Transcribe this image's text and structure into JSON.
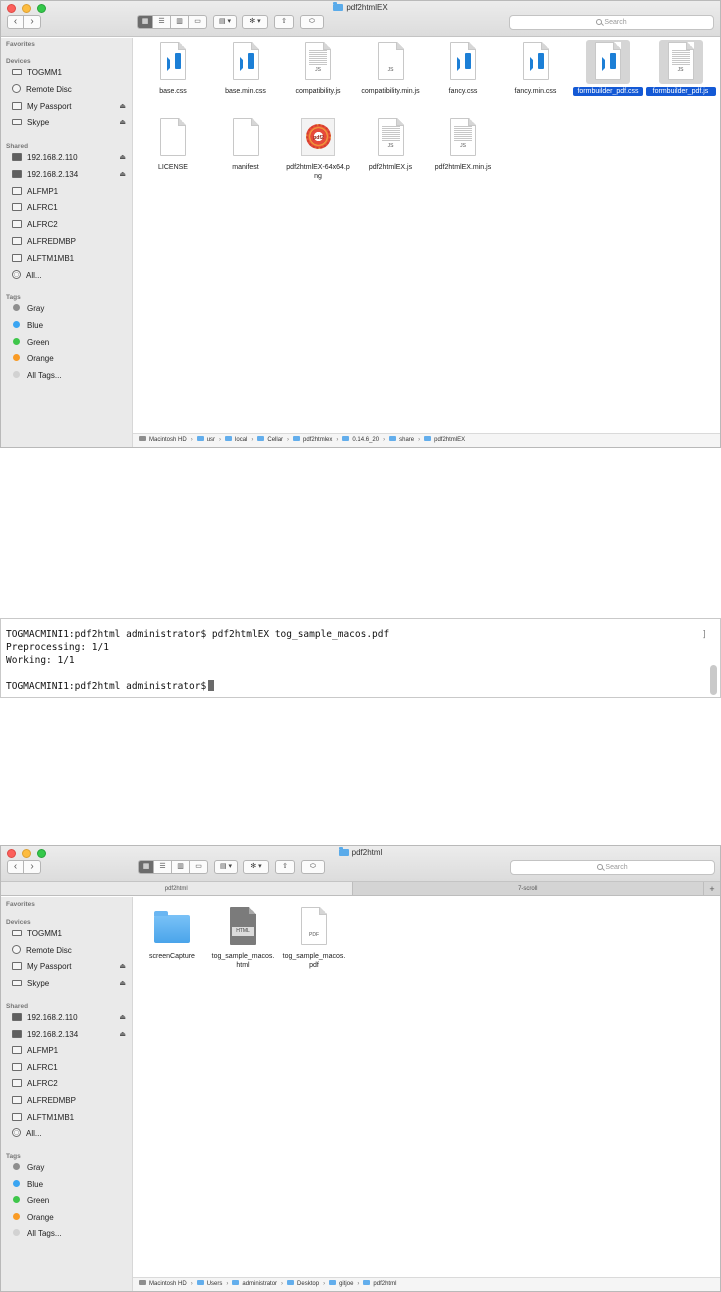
{
  "finder1": {
    "title": "pdf2htmlEX",
    "search_placeholder": "Search",
    "sidebar": {
      "favorites_header": "Favorites",
      "devices_header": "Devices",
      "devices": [
        {
          "label": "TOGMM1",
          "icon": "drive-icon"
        },
        {
          "label": "Remote Disc",
          "icon": "disc-icon"
        },
        {
          "label": "My Passport",
          "icon": "external-drive-icon",
          "eject": "⏏"
        },
        {
          "label": "Skype",
          "icon": "drive-icon",
          "eject": "⏏"
        }
      ],
      "shared_header": "Shared",
      "shared": [
        {
          "label": "192.168.2.110",
          "eject": "⏏"
        },
        {
          "label": "192.168.2.134",
          "eject": "⏏"
        },
        {
          "label": "ALFMP1"
        },
        {
          "label": "ALFRC1"
        },
        {
          "label": "ALFRC2"
        },
        {
          "label": "ALFREDMBP"
        },
        {
          "label": "ALFTM1MB1"
        },
        {
          "label": "All..."
        }
      ],
      "tags_header": "Tags",
      "tags": [
        {
          "label": "Gray",
          "color": "#8e8e8e"
        },
        {
          "label": "Blue",
          "color": "#3aa5f2"
        },
        {
          "label": "Green",
          "color": "#3fc64b"
        },
        {
          "label": "Orange",
          "color": "#f99b25"
        },
        {
          "label": "All Tags...",
          "color": "#d2d2d2"
        }
      ]
    },
    "files": [
      {
        "name": "base.css",
        "kind": "vscode"
      },
      {
        "name": "base.min.css",
        "kind": "vscode"
      },
      {
        "name": "compatibility.js",
        "kind": "js-lines",
        "ext": "JS"
      },
      {
        "name": "compatibility.min.js",
        "kind": "js",
        "ext": "JS"
      },
      {
        "name": "fancy.css",
        "kind": "vscode"
      },
      {
        "name": "fancy.min.css",
        "kind": "vscode"
      },
      {
        "name": "formbuilder_pdf.css",
        "kind": "vscode",
        "selected": true
      },
      {
        "name": "formbuilder_pdf.js",
        "kind": "js-lines",
        "ext": "JS",
        "selected": true
      },
      {
        "name": "LICENSE",
        "kind": "blank"
      },
      {
        "name": "manifest",
        "kind": "blank"
      },
      {
        "name": "pdf2htmlEX-64x64.png",
        "kind": "png",
        "badge": "pdf2"
      },
      {
        "name": "pdf2htmlEX.js",
        "kind": "js-lines",
        "ext": "JS"
      },
      {
        "name": "pdf2htmlEX.min.js",
        "kind": "js-lines",
        "ext": "JS"
      }
    ],
    "path": [
      "Macintosh HD",
      "usr",
      "local",
      "Cellar",
      "pdf2htmlex",
      "0.14.6_20",
      "share",
      "pdf2htmlEX"
    ]
  },
  "terminal": {
    "lines": [
      "TOGMACMINI1:pdf2html administrator$ pdf2htmlEX tog_sample_macos.pdf",
      "Preprocessing: 1/1",
      "Working: 1/1",
      "",
      "TOGMACMINI1:pdf2html administrator$"
    ]
  },
  "finder2": {
    "title": "pdf2html",
    "search_placeholder": "Search",
    "tabs": [
      "pdf2html",
      "7-scroll"
    ],
    "tab_add": "+",
    "sidebar": {
      "favorites_header": "Favorites",
      "devices_header": "Devices",
      "devices": [
        {
          "label": "TOGMM1",
          "icon": "drive-icon"
        },
        {
          "label": "Remote Disc",
          "icon": "disc-icon"
        },
        {
          "label": "My Passport",
          "icon": "external-drive-icon",
          "eject": "⏏"
        },
        {
          "label": "Skype",
          "icon": "drive-icon",
          "eject": "⏏"
        }
      ],
      "shared_header": "Shared",
      "shared": [
        {
          "label": "192.168.2.110",
          "eject": "⏏"
        },
        {
          "label": "192.168.2.134",
          "eject": "⏏"
        },
        {
          "label": "ALFMP1"
        },
        {
          "label": "ALFRC1"
        },
        {
          "label": "ALFRC2"
        },
        {
          "label": "ALFREDMBP"
        },
        {
          "label": "ALFTM1MB1"
        },
        {
          "label": "All..."
        }
      ],
      "tags_header": "Tags",
      "tags": [
        {
          "label": "Gray",
          "color": "#8e8e8e"
        },
        {
          "label": "Blue",
          "color": "#3aa5f2"
        },
        {
          "label": "Green",
          "color": "#3fc64b"
        },
        {
          "label": "Orange",
          "color": "#f99b25"
        },
        {
          "label": "All Tags...",
          "color": "#d2d2d2"
        }
      ]
    },
    "files": [
      {
        "name": "screenCapture",
        "kind": "folder"
      },
      {
        "name": "tog_sample_macos.html",
        "kind": "html",
        "ext": "HTML"
      },
      {
        "name": "tog_sample_macos.pdf",
        "kind": "pdf",
        "ext": "PDF"
      }
    ],
    "path": [
      "Macintosh HD",
      "Users",
      "administrator",
      "Desktop",
      "gitjoe",
      "pdf2html"
    ]
  },
  "toolbar": {
    "back": "‹",
    "forward": "›",
    "view_icon": "▦",
    "view_list": "☰",
    "view_column": "▥",
    "view_cover": "▭",
    "arrange": "▤ ▾",
    "action": "✻ ▾",
    "share": "⇧",
    "tag": "⬭"
  }
}
